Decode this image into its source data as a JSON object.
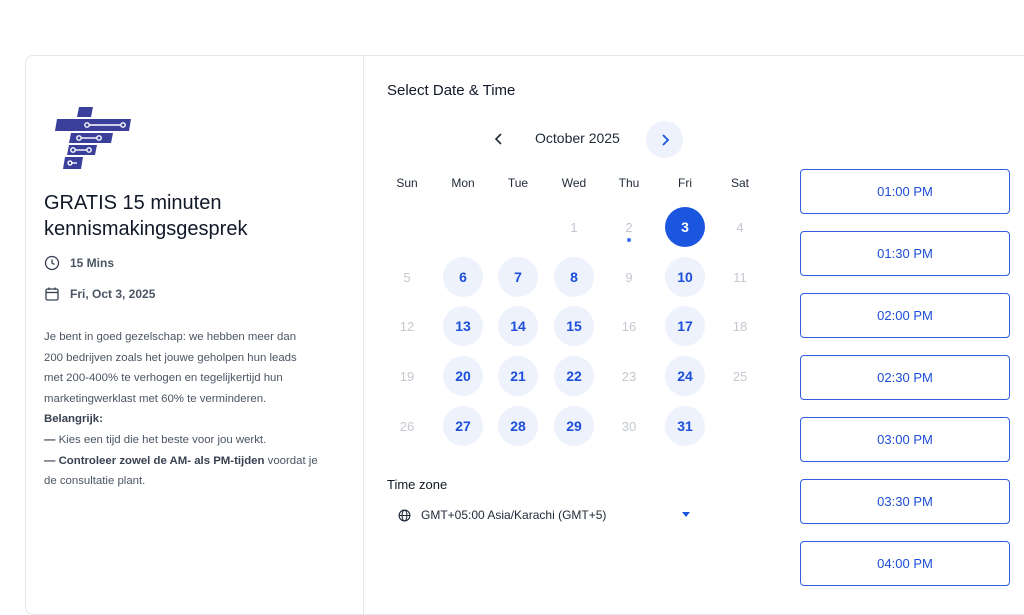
{
  "event": {
    "title_line1": "GRATIS 15 minuten",
    "title_line2": "kennismakingsgesprek",
    "duration": "15 Mins",
    "date": "Fri, Oct 3, 2025",
    "desc_line1": "Je bent in goed gezelschap: we hebben meer dan",
    "desc_line2": "200 bedrijven zoals het jouwe geholpen hun leads",
    "desc_line3": "met 200-400% te verhogen en tegelijkertijd hun",
    "desc_line4": "marketingwerklast met 60% te verminderen.",
    "important_label": "Belangrijk:",
    "bullet1": "Kies een tijd die het beste voor jou werkt.",
    "bullet2_bold": "Controleer zowel de AM- als PM-tijden",
    "bullet2_rest": " voordat je",
    "bullet2_line2": "de consultatie plant.",
    "dash": "—",
    "logo_color": "#3b3f9c"
  },
  "scheduler": {
    "section_title": "Select Date & Time",
    "month_label": "October 2025",
    "weekdays": [
      "Sun",
      "Mon",
      "Tue",
      "Wed",
      "Thu",
      "Fri",
      "Sat"
    ],
    "days": [
      {
        "n": "1",
        "state": "disabled"
      },
      {
        "n": "2",
        "state": "disabled",
        "today": true
      },
      {
        "n": "3",
        "state": "selected"
      },
      {
        "n": "4",
        "state": "disabled"
      },
      {
        "n": "5",
        "state": "disabled"
      },
      {
        "n": "6",
        "state": "available"
      },
      {
        "n": "7",
        "state": "available"
      },
      {
        "n": "8",
        "state": "available"
      },
      {
        "n": "9",
        "state": "disabled"
      },
      {
        "n": "10",
        "state": "available"
      },
      {
        "n": "11",
        "state": "disabled"
      },
      {
        "n": "12",
        "state": "disabled"
      },
      {
        "n": "13",
        "state": "available"
      },
      {
        "n": "14",
        "state": "available"
      },
      {
        "n": "15",
        "state": "available"
      },
      {
        "n": "16",
        "state": "disabled"
      },
      {
        "n": "17",
        "state": "available"
      },
      {
        "n": "18",
        "state": "disabled"
      },
      {
        "n": "19",
        "state": "disabled"
      },
      {
        "n": "20",
        "state": "available"
      },
      {
        "n": "21",
        "state": "available"
      },
      {
        "n": "22",
        "state": "available"
      },
      {
        "n": "23",
        "state": "disabled"
      },
      {
        "n": "24",
        "state": "available"
      },
      {
        "n": "25",
        "state": "disabled"
      },
      {
        "n": "26",
        "state": "disabled"
      },
      {
        "n": "27",
        "state": "available"
      },
      {
        "n": "28",
        "state": "available"
      },
      {
        "n": "29",
        "state": "available"
      },
      {
        "n": "30",
        "state": "disabled"
      },
      {
        "n": "31",
        "state": "available"
      }
    ],
    "timezone_label": "Time zone",
    "timezone_value": "GMT+05:00 Asia/Karachi (GMT+5)",
    "time_slots": [
      "01:00 PM",
      "01:30 PM",
      "02:00 PM",
      "02:30 PM",
      "03:00 PM",
      "03:30 PM",
      "04:00 PM"
    ],
    "accent_color": "#1b56de"
  }
}
